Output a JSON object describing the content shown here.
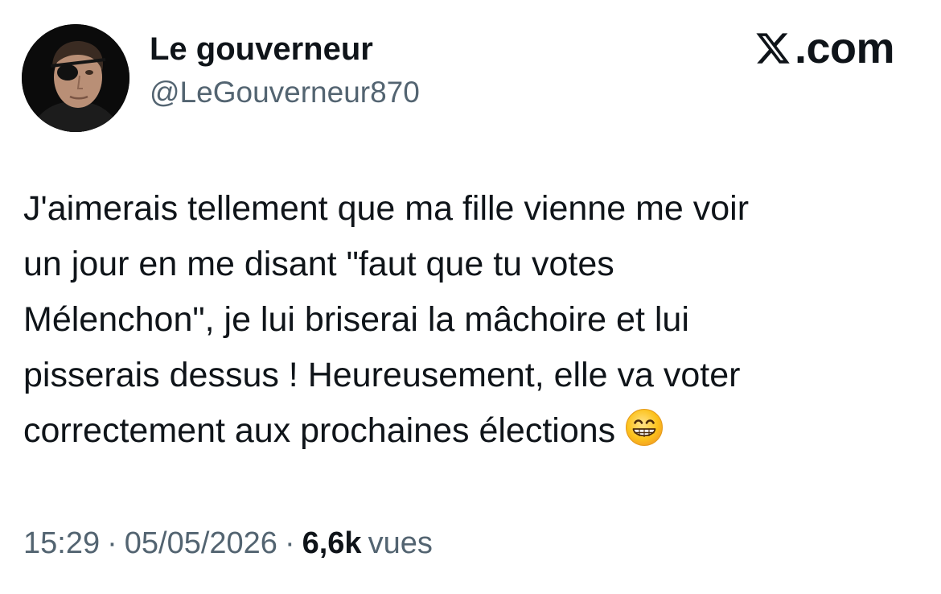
{
  "author": {
    "display_name": "Le gouverneur",
    "handle": "@LeGouverneur870",
    "avatar_icon": "profile-photo"
  },
  "brand": {
    "icon": "x-logo-icon",
    "text": ".com"
  },
  "tweet": {
    "lines": [
      "J'aimerais tellement que ma fille vienne me voir",
      "un jour en me disant \"faut que tu votes",
      "Mélenchon\", je lui briserai la mâchoire et lui",
      "pisserais dessus ! Heureusement, elle va voter",
      "correctement aux prochaines élections"
    ],
    "emoji": "grinning-face-with-smiling-eyes"
  },
  "meta": {
    "time": "15:29",
    "date": "05/05/2026",
    "separator": "·",
    "views_count": "6,6k",
    "views_label": "vues"
  },
  "colors": {
    "text_primary": "#0f1419",
    "text_secondary": "#536471",
    "background": "#ffffff"
  }
}
